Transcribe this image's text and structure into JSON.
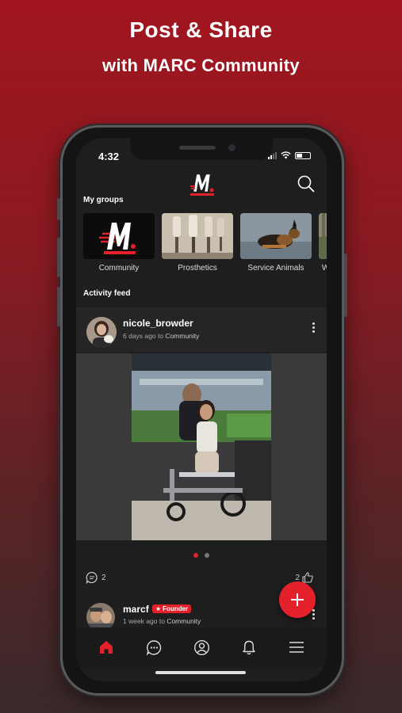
{
  "promo": {
    "title": "Post & Share",
    "subtitle": "with MARC Community"
  },
  "status_bar": {
    "time": "4:32"
  },
  "app": {
    "logo_icon": "marc-m-logo",
    "search_icon": "search-icon"
  },
  "groups_section": {
    "label": "My groups",
    "items": [
      {
        "label": "Community",
        "image": "marc-logo"
      },
      {
        "label": "Prosthetics",
        "image": "prosthetic-legs"
      },
      {
        "label": "Service Animals",
        "image": "german-shepherd"
      },
      {
        "label": "W",
        "image": "partial-tile"
      }
    ]
  },
  "feed": {
    "label": "Activity feed",
    "posts": [
      {
        "username": "nicole_browder",
        "time": "6 days ago to",
        "group": "Community",
        "comments": "2",
        "likes": "2",
        "carousel_pages": 2,
        "carousel_active": 1
      },
      {
        "username": "marcf",
        "badge": "Founder",
        "time": "1 week ago to",
        "group": "Community"
      }
    ]
  },
  "tabbar": [
    "home-icon",
    "chat-icon",
    "profile-icon",
    "bell-icon",
    "menu-icon"
  ],
  "colors": {
    "accent": "#e4202b",
    "background": "#1e1e1e",
    "card": "#252525"
  }
}
